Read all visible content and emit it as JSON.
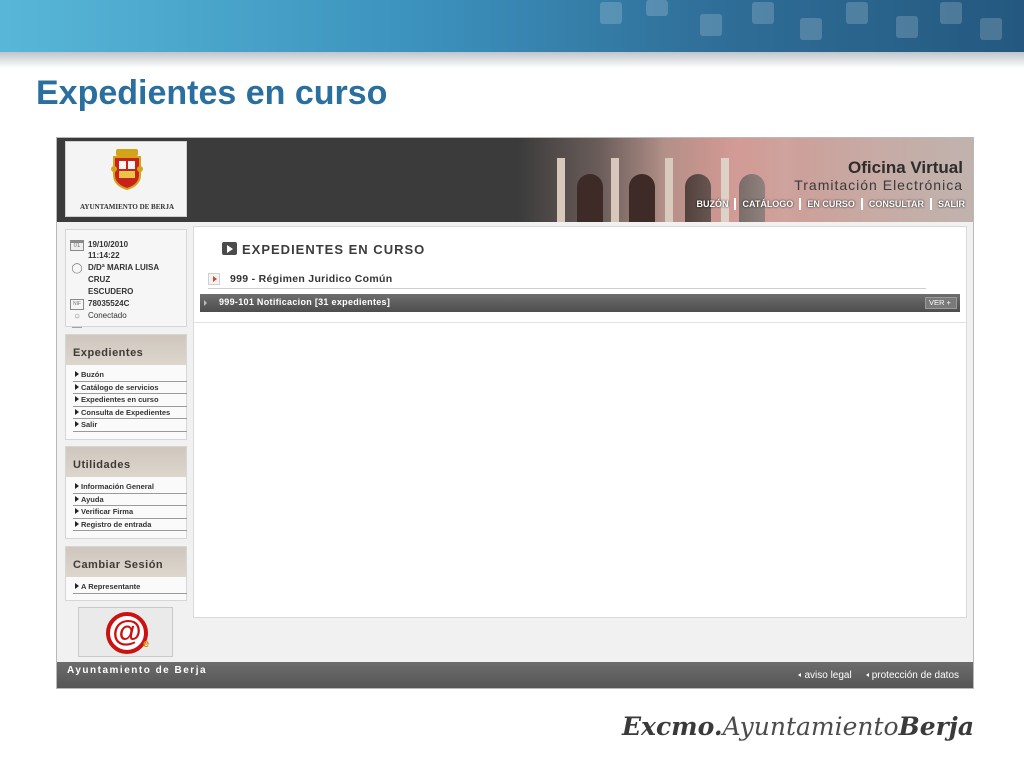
{
  "slide": {
    "title": "Expedientes en curso",
    "footer_signature_part1": "Excmo.",
    "footer_signature_part2": "Ayuntamiento",
    "footer_signature_part3": "Berja"
  },
  "header": {
    "logo_text": "AYUNTAMIENTO DE BERJA",
    "app_title": "Oficina Virtual",
    "app_subtitle": "Tramitación Electrónica",
    "nav": [
      "BUZÓN",
      "CATÁLOGO",
      "EN CURSO",
      "CONSULTAR",
      "SALIR"
    ]
  },
  "user": {
    "date": "19/10/2010",
    "time": "11:14:22",
    "name_line1": "D/Dª MARIA LUISA",
    "name_line2": "CRUZ",
    "name_line3": "ESCUDERO",
    "nif": "78035524C",
    "status": "Conectado",
    "calendar_icon_text": "01",
    "nif_icon_text": "NIF"
  },
  "sidebar": {
    "expedientes": {
      "heading": "Expedientes",
      "items": [
        "Buzón",
        "Catálogo de servicios",
        "Expedientes en curso",
        "Consulta de Expedientes",
        "Salir"
      ]
    },
    "utilidades": {
      "heading": "Utilidades",
      "items": [
        "Información General",
        "Ayuda",
        "Verificar Firma",
        "Registro de entrada"
      ]
    },
    "cambiar_sesion": {
      "heading": "Cambiar Sesión",
      "items": [
        "A Representante"
      ]
    }
  },
  "main": {
    "title": "EXPEDIENTES EN CURSO",
    "group_label": "999 - Régimen Juridico Común",
    "subgroup_label": "999-101 Notificacion [31 expedientes]",
    "view_button": "VER +"
  },
  "footer": {
    "left": "Ayuntamiento de Berja",
    "links": [
      "aviso legal",
      "protección de datos"
    ]
  },
  "colors": {
    "title_blue": "#2a6f9e",
    "header_dark": "#3b3b3b",
    "menu_head": "#cfc7bd"
  }
}
